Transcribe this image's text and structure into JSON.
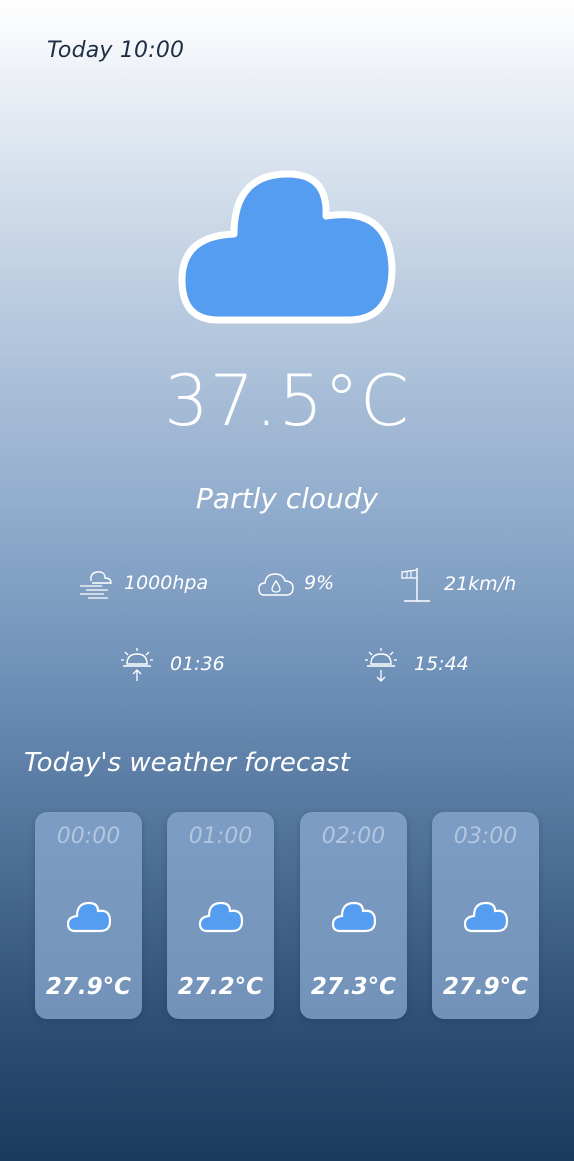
{
  "header": {
    "time_label": "Today 10:00"
  },
  "current": {
    "icon": "cloud-icon",
    "temperature": "37.5°C",
    "condition": "Partly cloudy",
    "pressure": "1000hpa",
    "humidity": "9%",
    "wind": "21km/h",
    "sunrise": "01:36",
    "sunset": "15:44"
  },
  "forecast": {
    "title": "Today's weather forecast",
    "items": [
      {
        "hour": "00:00",
        "icon": "cloud-icon",
        "temp": "27.9°C"
      },
      {
        "hour": "01:00",
        "icon": "cloud-icon",
        "temp": "27.2°C"
      },
      {
        "hour": "02:00",
        "icon": "cloud-icon",
        "temp": "27.3°C"
      },
      {
        "hour": "03:00",
        "icon": "cloud-icon",
        "temp": "27.9°C"
      }
    ]
  },
  "colors": {
    "cloud_fill": "#559df0",
    "gradient_top": "#ffffff",
    "gradient_bottom": "#1c3a5e",
    "card_bg": "#8eacd2"
  }
}
